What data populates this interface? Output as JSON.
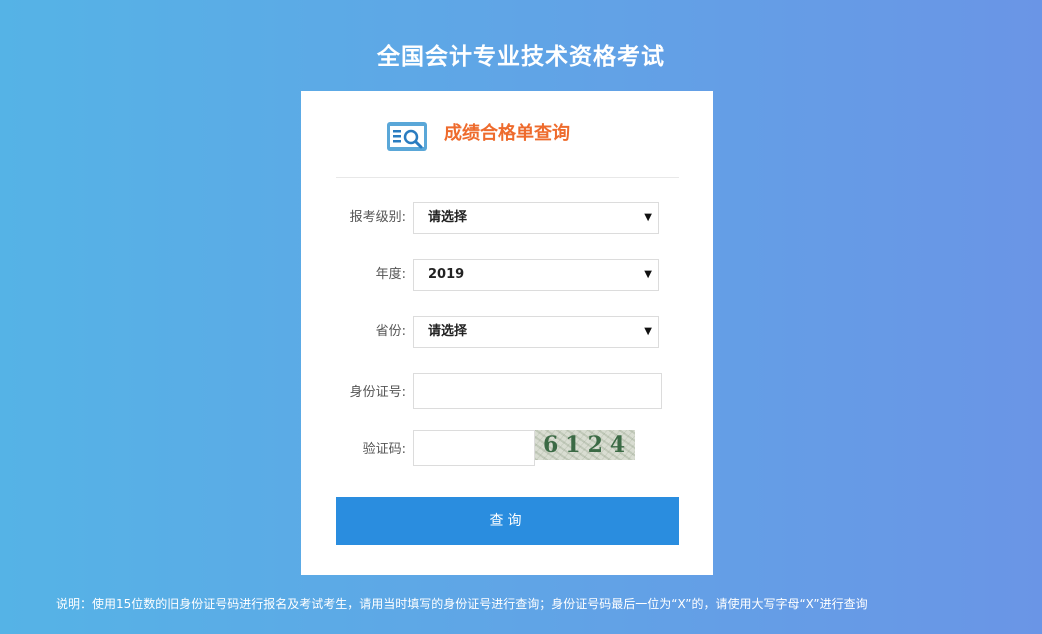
{
  "page": {
    "title": "全国会计专业技术资格考试"
  },
  "card": {
    "title": "成绩合格单查询",
    "icon": "search-document-icon"
  },
  "form": {
    "level": {
      "label": "报考级别:",
      "value": "请选择"
    },
    "year": {
      "label": "年度:",
      "value": "2019"
    },
    "province": {
      "label": "省份:",
      "value": "请选择"
    },
    "id_number": {
      "label": "身份证号:",
      "value": ""
    },
    "captcha": {
      "label": "验证码:",
      "value": "",
      "code": "6124"
    },
    "submit_label": "查询"
  },
  "footer": {
    "note": "说明：使用15位数的旧身份证号码进行报名及考试考生，请用当时填写的身份证号进行查询；身份证号码最后一位为“X”的，请使用大写字母“X”进行查询"
  },
  "colors": {
    "accent": "#2a8ddf",
    "title_orange": "#ee6b2d"
  }
}
